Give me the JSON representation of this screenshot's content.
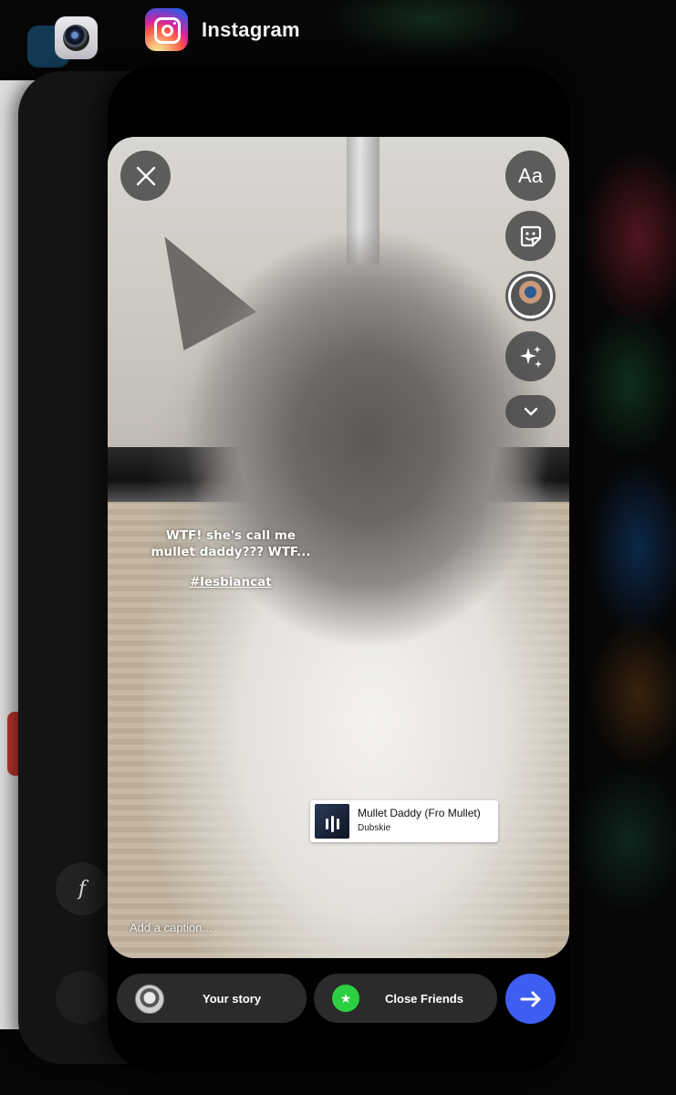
{
  "switcher": {
    "app_label": "Instagram",
    "icons": [
      "back-app-icon",
      "camera-app-icon",
      "instagram-app-icon"
    ]
  },
  "background_card": {
    "f_glyph": "f"
  },
  "story_editor": {
    "tools": {
      "text_label": "Aa",
      "icons": [
        "close-icon",
        "text-icon",
        "sticker-icon",
        "avatar-icon",
        "effects-sparkle-icon",
        "chevron-down-icon"
      ]
    },
    "text_overlay": "WTF! she's call me mullet daddy??? WTF...",
    "hashtag": "#lesbiancat",
    "music_sticker": {
      "title": "Mullet Daddy (Fro Mullet)",
      "artist": "Dubskie"
    },
    "caption_placeholder": "Add a caption...",
    "share": {
      "your_story": "Your story",
      "close_friends": "Close Friends"
    },
    "colors": {
      "send_button": "#3e5ef2",
      "close_friends_green": "#2bd040"
    }
  }
}
